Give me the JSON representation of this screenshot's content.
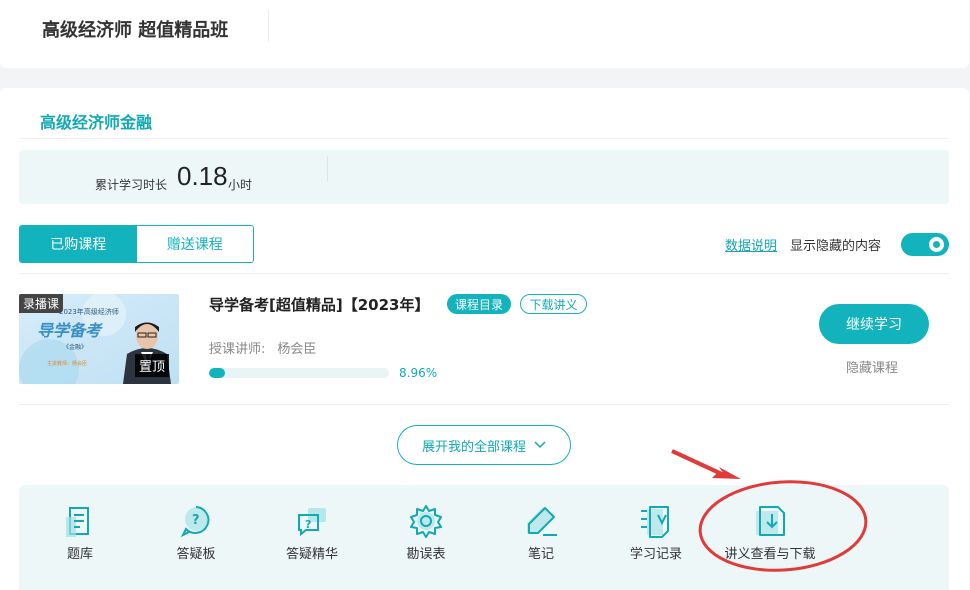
{
  "header": {
    "title": "高级经济师 超值精品班"
  },
  "subject": {
    "name": "高级经济师金融"
  },
  "stats": {
    "label": "累计学习时长",
    "value": "0.18",
    "unit": "小时"
  },
  "tabs": [
    {
      "label": "已购课程",
      "active": true
    },
    {
      "label": "赠送课程",
      "active": false
    }
  ],
  "controls": {
    "data_note": "数据说明",
    "show_hidden": "显示隐藏的内容",
    "show_hidden_on": true
  },
  "course": {
    "thumb_badge": "录播课",
    "pin_badge": "置顶",
    "thumb_line1": "2023年高级经济师",
    "thumb_line2": "导学备考",
    "thumb_line3": "《金融》",
    "thumb_line4": "主讲教师：杨会臣",
    "title": "导学备考[超值精品]【2023年】",
    "catalog_label": "课程目录",
    "download_label": "下载讲义",
    "teacher_label": "授课讲师:",
    "teacher_name": "杨会臣",
    "progress": 0.0896,
    "progress_text": "8.96%",
    "continue_label": "继续学习",
    "hide_label": "隐藏课程"
  },
  "expand": {
    "label": "展开我的全部课程"
  },
  "tools": [
    {
      "label": "题库",
      "icon": "question-bank-icon"
    },
    {
      "label": "答疑板",
      "icon": "qa-board-icon"
    },
    {
      "label": "答疑精华",
      "icon": "qa-highlights-icon"
    },
    {
      "label": "勘误表",
      "icon": "gear-icon"
    },
    {
      "label": "笔记",
      "icon": "pen-note-icon"
    },
    {
      "label": "学习记录",
      "icon": "study-record-icon"
    },
    {
      "label": "讲义查看与下载",
      "icon": "handout-download-icon"
    }
  ],
  "colors": {
    "accent": "#12b3bd",
    "annotation": "#e03a3a"
  }
}
